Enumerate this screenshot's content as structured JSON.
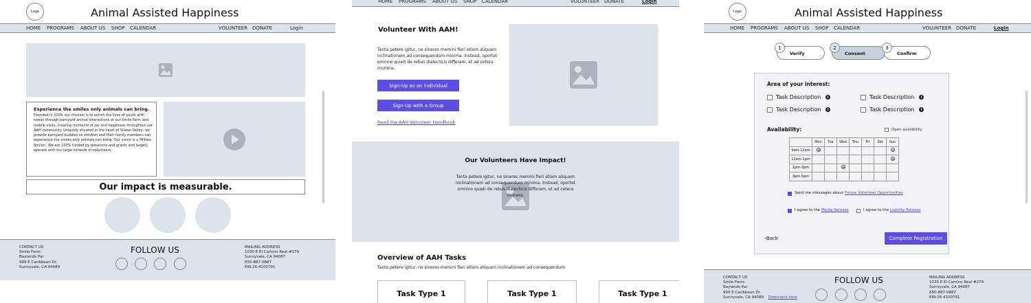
{
  "site": {
    "logo": "Logo",
    "brand": "Animal Assisted Happiness"
  },
  "nav": {
    "home": "HOME",
    "programs": "PROGRAMS",
    "about": "ABOUT US",
    "shop": "SHOP",
    "calendar": "CALENDAR",
    "volunteer": "VOLUNTEER",
    "donate": "DONATE",
    "login": "Login"
  },
  "home": {
    "about_title": "Experience the smiles only animals can bring.",
    "about_body": "Founded in 2009, our mission is to enrich the lives of youth with needs through barnyard animal interactions at our Smile Farm and mobile visits, creating moments of joy and happiness throughout our AAH community. Uniquely situated in the heart of Silicon Valley, we provide barnyard buddies so children and their family members can experience the smiles only animals can bring. Our vision is a 'Million Smiles'. We are 100% funded by donations and grants and largely operate with our large network of volunteers.",
    "impact": "Our impact is measurable."
  },
  "footer": {
    "contact": "CONTACT US\nSmile Farm:\nBaylands Par\n999 E Caribbean Dr.\nSunnyvale, CA 94089",
    "follow": "FOLLOW US",
    "mailing": "MAILING ADDRESS\n1030 E El Camino Real #279\nSunnyvale, CA 94087\n650-887-0887\nEIN:26-4100791",
    "contact3": "CONTACT US\nSmile Farm:\nBaylands Par\n999 E Caribbean Dr.\nSunnyvale, CA 94089",
    "directions": "Directions here"
  },
  "volunteer": {
    "title": "Volunteer With AAH!",
    "body": "Tanta petere igitur, ne sineres memini fieri etiam aliquam inclinationem ad consequendum minima. Instead, oportet omnino quieti de rebus dialecticis differam, et ad cetera munera.",
    "btn_individual": "Sign-Up as an Individual",
    "btn_group": "Sign-Up with a Group",
    "handbook": "Read the AAH Volunteer Handbook",
    "impact_title": "Our Volunteers Have Impact!",
    "impact_body": "Tanta petere igitur, ne sineres memini fieri etiam aliquam inclinationem ad consequendum minima. Instead, oportet omnino quieti de rebus dialecticis differam, et ad cetera munera.",
    "overview_title": "Overview of AAH Tasks",
    "overview_body": "Tanta petere igitur, ne sineres memini fieri etiam aliquam inclinationem ad consequendum",
    "tasks": [
      "Task Type 1",
      "Task Type 1",
      "Task Type 1"
    ]
  },
  "registration": {
    "steps": [
      {
        "num": "1",
        "label": "Verify"
      },
      {
        "num": "2",
        "label": "Consent"
      },
      {
        "num": "3",
        "label": "Confirm"
      }
    ],
    "interest_title": "Area of your interest:",
    "interests": [
      "Task Description",
      "Task Description",
      "Task Description",
      "Task Description"
    ],
    "availability_title": "Availability:",
    "open_availability": "Open availibility",
    "days": [
      "Mon",
      "Tue",
      "Wed",
      "Thu",
      "Fri",
      "Sat",
      "Sun"
    ],
    "slots": [
      "9am-11am",
      "11am-1pm",
      "1pm-3pm",
      "3pm-5pm"
    ],
    "send_messages": "Send me messages about",
    "future_link": "Future Volunteer Opportunities",
    "agree_media": "I agree to the",
    "media_link": "Media Release",
    "agree_liability": "I agree to the",
    "liability_link": "Liability Release",
    "back": "Back",
    "complete": "Complete Registration"
  },
  "colors": {
    "accent": "#5b4de6",
    "placeholder": "#dde3eb"
  }
}
